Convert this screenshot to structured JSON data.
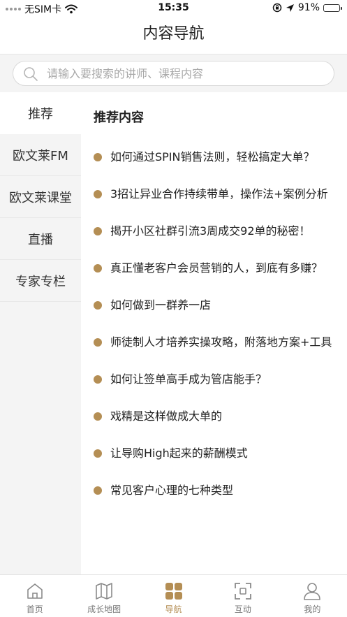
{
  "status_bar": {
    "carrier": "无SIM卡",
    "time": "15:35",
    "battery": "91%",
    "battery_level": 0.91
  },
  "nav": {
    "title": "内容导航"
  },
  "search": {
    "placeholder": "请输入要搜索的讲师、课程内容",
    "value": ""
  },
  "sidebar": {
    "items": [
      {
        "label": "推荐",
        "active": true
      },
      {
        "label": "欧文莱FM"
      },
      {
        "label": "欧文莱课堂"
      },
      {
        "label": "直播"
      },
      {
        "label": "专家专栏"
      }
    ]
  },
  "main": {
    "section_title": "推荐内容",
    "items": [
      "如何通过SPIN销售法则，轻松搞定大单？",
      "3招让异业合作持续带单，操作法+案例分析",
      "揭开小区社群引流3周成交92单的秘密！",
      "真正懂老客户会员营销的人，到底有多赚？",
      "如何做到一群养一店",
      "师徒制人才培养实操攻略，附落地方案+工具",
      "如何让签单高手成为管店能手？",
      "戏精是这样做成大单的",
      "让导购High起来的薪酬模式",
      "常见客户心理的七种类型"
    ]
  },
  "tabbar": {
    "items": [
      {
        "label": "首页",
        "icon": "home-icon"
      },
      {
        "label": "成长地图",
        "icon": "map-icon"
      },
      {
        "label": "导航",
        "icon": "grid-icon",
        "active": true
      },
      {
        "label": "互动",
        "icon": "scan-icon"
      },
      {
        "label": "我的",
        "icon": "user-icon"
      }
    ]
  },
  "colors": {
    "accent": "#b48e54",
    "sidebar_bg": "#f4f4f4",
    "text": "#222222"
  }
}
